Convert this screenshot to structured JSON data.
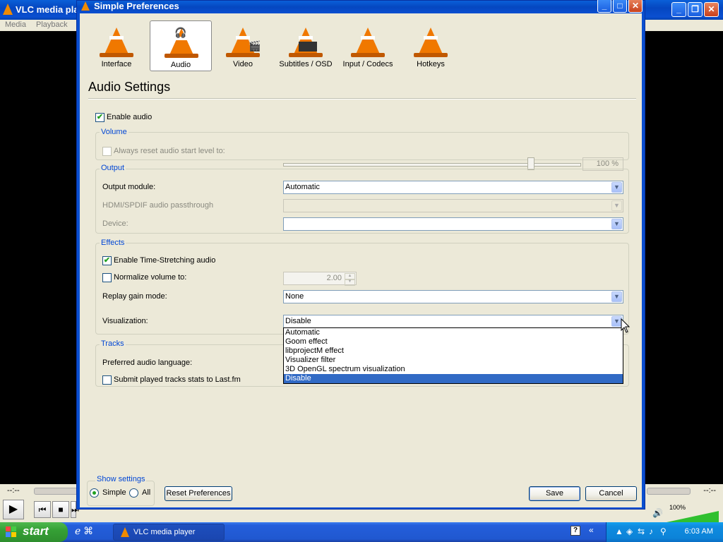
{
  "vlc": {
    "title": "VLC media pla",
    "menu": [
      "Media",
      "Playback"
    ],
    "time_left": "--:--",
    "time_right": "--:--",
    "volume": "100%"
  },
  "dialog": {
    "title": "Simple Preferences",
    "categories": [
      {
        "label": "Interface"
      },
      {
        "label": "Audio"
      },
      {
        "label": "Video"
      },
      {
        "label": "Subtitles / OSD"
      },
      {
        "label": "Input / Codecs"
      },
      {
        "label": "Hotkeys"
      }
    ],
    "heading": "Audio Settings",
    "enable_audio": "Enable audio",
    "volume": {
      "group": "Volume",
      "reset_label": "Always reset audio start level to:",
      "value": "100 %",
      "level": 0.84
    },
    "output": {
      "group": "Output",
      "module_label": "Output module:",
      "module_value": "Automatic",
      "hdmi_label": "HDMI/SPDIF audio passthrough",
      "hdmi_value": "",
      "device_label": "Device:",
      "device_value": ""
    },
    "effects": {
      "group": "Effects",
      "timestretch_label": "Enable Time-Stretching audio",
      "normalize_label": "Normalize volume to:",
      "normalize_value": "2.00",
      "replay_label": "Replay gain mode:",
      "replay_value": "None",
      "visual_label": "Visualization:",
      "visual_value": "Disable",
      "visual_options": [
        "Automatic",
        "Goom effect",
        "libprojectM effect",
        "Visualizer filter",
        "3D OpenGL spectrum visualization",
        "Disable"
      ]
    },
    "tracks": {
      "group": "Tracks",
      "pref_lang_label": "Preferred audio language:",
      "lastfm_label": "Submit played tracks stats to Last.fm"
    },
    "show_settings": {
      "group": "Show settings",
      "simple": "Simple",
      "all": "All"
    },
    "reset_btn": "Reset Preferences",
    "save_btn": "Save",
    "cancel_btn": "Cancel"
  },
  "taskbar": {
    "start": "start",
    "task": "VLC media player",
    "clock": "6:03 AM"
  },
  "colors": {
    "xp_blue": "#0a4fd0",
    "group_title": "#0046d5",
    "selection": "#316ac5",
    "check_green": "#21a121"
  }
}
